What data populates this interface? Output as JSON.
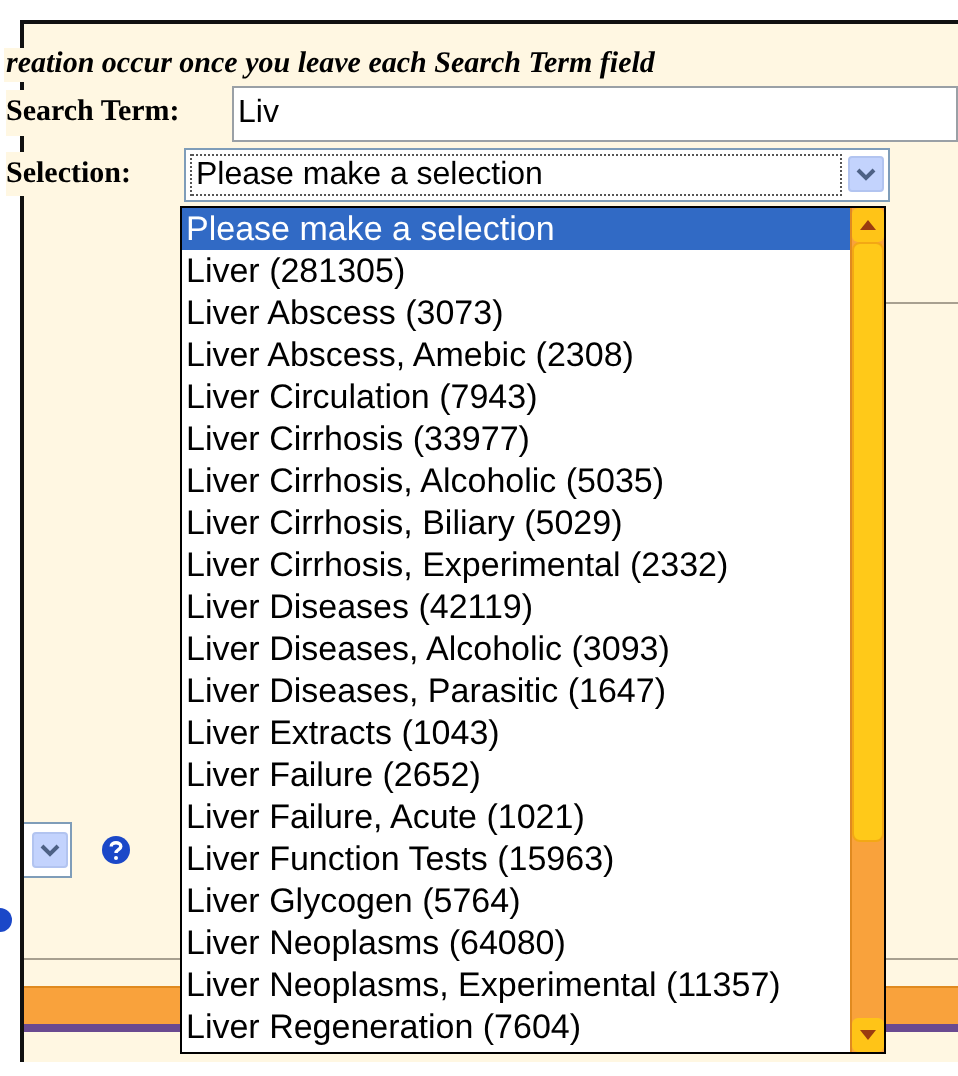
{
  "instruction": "reation occur once you leave each Search Term field",
  "search_term": {
    "label": "Search Term:",
    "value": "Liv"
  },
  "selection": {
    "label": "Selection:",
    "value": "Please make a selection"
  },
  "dropdown": {
    "options": [
      {
        "label": "Please make a selection",
        "selected": true
      },
      {
        "label": "Liver (281305)",
        "selected": false
      },
      {
        "label": "Liver Abscess (3073)",
        "selected": false
      },
      {
        "label": "Liver Abscess, Amebic (2308)",
        "selected": false
      },
      {
        "label": "Liver Circulation (7943)",
        "selected": false
      },
      {
        "label": "Liver Cirrhosis (33977)",
        "selected": false
      },
      {
        "label": "Liver Cirrhosis, Alcoholic (5035)",
        "selected": false
      },
      {
        "label": "Liver Cirrhosis, Biliary (5029)",
        "selected": false
      },
      {
        "label": "Liver Cirrhosis, Experimental (2332)",
        "selected": false
      },
      {
        "label": "Liver Diseases (42119)",
        "selected": false
      },
      {
        "label": "Liver Diseases, Alcoholic (3093)",
        "selected": false
      },
      {
        "label": "Liver Diseases, Parasitic (1647)",
        "selected": false
      },
      {
        "label": "Liver Extracts (1043)",
        "selected": false
      },
      {
        "label": "Liver Failure (2652)",
        "selected": false
      },
      {
        "label": "Liver Failure, Acute (1021)",
        "selected": false
      },
      {
        "label": "Liver Function Tests (15963)",
        "selected": false
      },
      {
        "label": "Liver Glycogen (5764)",
        "selected": false
      },
      {
        "label": "Liver Neoplasms (64080)",
        "selected": false
      },
      {
        "label": "Liver Neoplasms, Experimental (11357)",
        "selected": false
      },
      {
        "label": "Liver Regeneration (7604)",
        "selected": false
      }
    ]
  }
}
